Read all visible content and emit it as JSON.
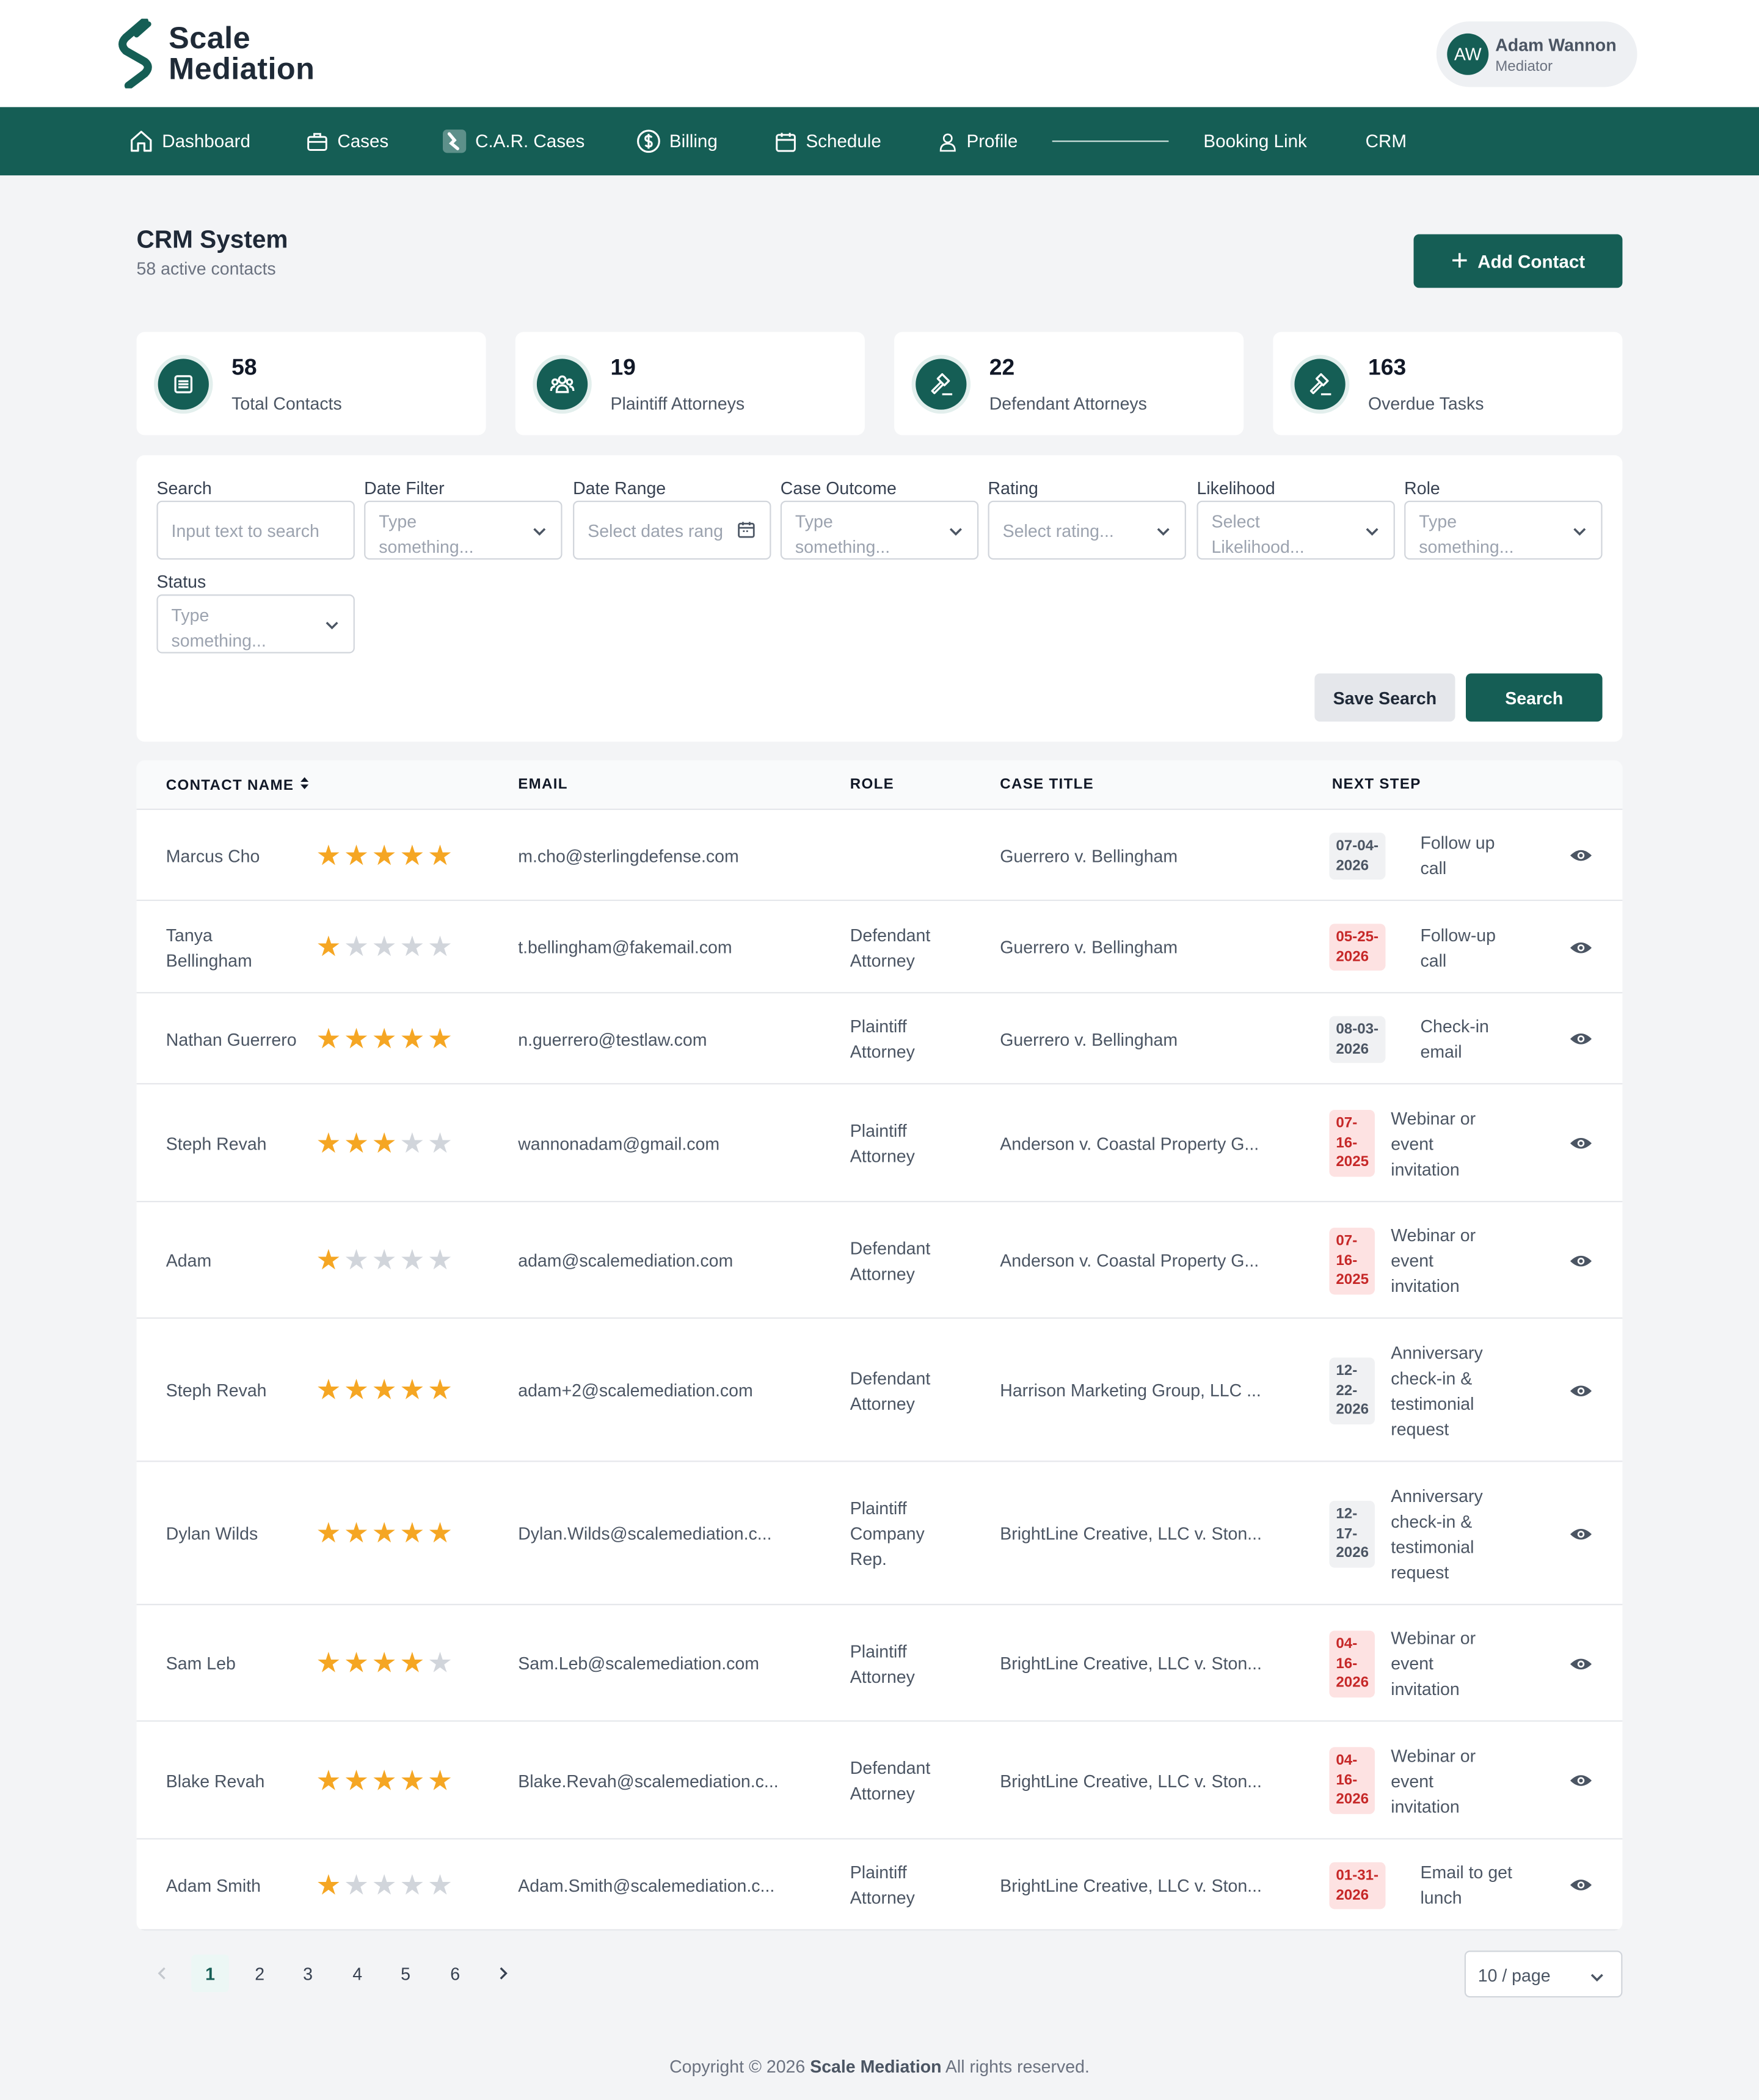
{
  "brand": {
    "line1": "Scale",
    "line2": "Mediation"
  },
  "user": {
    "initials": "AW",
    "name": "Adam Wannon",
    "role": "Mediator"
  },
  "nav": [
    {
      "label": "Dashboard",
      "icon": "home-icon"
    },
    {
      "label": "Cases",
      "icon": "briefcase-icon"
    },
    {
      "label": "C.A.R. Cases",
      "icon": "car-cases-icon"
    },
    {
      "label": "Billing",
      "icon": "dollar-icon"
    },
    {
      "label": "Schedule",
      "icon": "calendar-icon"
    },
    {
      "label": "Profile",
      "icon": "user-icon"
    },
    {
      "label": "Booking Link"
    },
    {
      "label": "CRM"
    }
  ],
  "page": {
    "title": "CRM System",
    "subtitle": "58 active contacts",
    "add_label": "Add Contact"
  },
  "stats": [
    {
      "value": "58",
      "label": "Total Contacts",
      "icon": "list-icon"
    },
    {
      "value": "19",
      "label": "Plaintiff Attorneys",
      "icon": "group-icon"
    },
    {
      "value": "22",
      "label": "Defendant Attorneys",
      "icon": "gavel-icon"
    },
    {
      "value": "163",
      "label": "Overdue Tasks",
      "icon": "gavel-icon"
    }
  ],
  "filters": {
    "search": {
      "label": "Search",
      "placeholder": "Input text to search"
    },
    "date_filter": {
      "label": "Date Filter",
      "placeholder": "Type something..."
    },
    "date_range": {
      "label": "Date Range",
      "placeholder": "Select dates rang"
    },
    "case_outcome": {
      "label": "Case Outcome",
      "placeholder": "Type something..."
    },
    "rating": {
      "label": "Rating",
      "placeholder": "Select rating..."
    },
    "likelihood": {
      "label": "Likelihood",
      "placeholder": "Select Likelihood..."
    },
    "role": {
      "label": "Role",
      "placeholder": "Type something..."
    },
    "status": {
      "label": "Status",
      "placeholder": "Type something..."
    },
    "save_label": "Save Search",
    "search_label": "Search"
  },
  "table": {
    "headers": {
      "name": "CONTACT NAME",
      "email": "EMAIL",
      "role": "ROLE",
      "case": "CASE TITLE",
      "next": "NEXT STEP"
    },
    "rows": [
      {
        "name": "Marcus Cho",
        "rating": 5,
        "email": "m.cho@sterlingdefense.com",
        "role": "",
        "case": "Guerrero v. Bellingham",
        "date": "07-04-\n2026",
        "overdue": false,
        "step": "Follow up\ncall"
      },
      {
        "name": "Tanya\nBellingham",
        "rating": 1,
        "email": "t.bellingham@fakemail.com",
        "role": "Defendant\nAttorney",
        "case": "Guerrero v. Bellingham",
        "date": "05-25-\n2026",
        "overdue": true,
        "step": "Follow-up\ncall"
      },
      {
        "name": "Nathan Guerrero",
        "rating": 5,
        "email": "n.guerrero@testlaw.com",
        "role": "Plaintiff\nAttorney",
        "case": "Guerrero v. Bellingham",
        "date": "08-03-\n2026",
        "overdue": false,
        "step": "Check-in\nemail"
      },
      {
        "name": "Steph Revah",
        "rating": 3,
        "email": "wannonadam@gmail.com",
        "role": "Plaintiff\nAttorney",
        "case": "Anderson v. Coastal Property G...",
        "date": "07-\n16-\n2025",
        "overdue": true,
        "step": "Webinar or\nevent\ninvitation"
      },
      {
        "name": "Adam",
        "rating": 1,
        "email": "adam@scalemediation.com",
        "role": "Defendant\nAttorney",
        "case": "Anderson v. Coastal Property G...",
        "date": "07-\n16-\n2025",
        "overdue": true,
        "step": "Webinar or\nevent\ninvitation"
      },
      {
        "name": "Steph Revah",
        "rating": 5,
        "email": "adam+2@scalemediation.com",
        "role": "Defendant\nAttorney",
        "case": "Harrison Marketing Group, LLC ...",
        "date": "12-\n22-\n2026",
        "overdue": false,
        "step": "Anniversary\ncheck-in &\ntestimonial\nrequest"
      },
      {
        "name": "Dylan Wilds",
        "rating": 5,
        "email": "Dylan.Wilds@scalemediation.c...",
        "role": "Plaintiff\nCompany\nRep.",
        "case": "BrightLine Creative, LLC v. Ston...",
        "date": "12-\n17-\n2026",
        "overdue": false,
        "step": "Anniversary\ncheck-in &\ntestimonial\nrequest"
      },
      {
        "name": "Sam Leb",
        "rating": 4,
        "email": "Sam.Leb@scalemediation.com",
        "role": "Plaintiff\nAttorney",
        "case": "BrightLine Creative, LLC v. Ston...",
        "date": "04-\n16-\n2026",
        "overdue": true,
        "step": "Webinar or\nevent\ninvitation"
      },
      {
        "name": "Blake Revah",
        "rating": 5,
        "email": "Blake.Revah@scalemediation.c...",
        "role": "Defendant\nAttorney",
        "case": "BrightLine Creative, LLC v. Ston...",
        "date": "04-\n16-\n2026",
        "overdue": true,
        "step": "Webinar or\nevent\ninvitation"
      },
      {
        "name": "Adam Smith",
        "rating": 1,
        "email": "Adam.Smith@scalemediation.c...",
        "role": "Plaintiff\nAttorney",
        "case": "BrightLine Creative, LLC v. Ston...",
        "date": "01-31-\n2026",
        "overdue": true,
        "step": "Email to get\nlunch"
      }
    ]
  },
  "pagination": {
    "pages": [
      "1",
      "2",
      "3",
      "4",
      "5",
      "6"
    ],
    "current": "1",
    "per_page": "10 / page"
  },
  "footer": {
    "prefix": "Copyright © 2026",
    "brand": "Scale Mediation",
    "suffix": "All rights reserved."
  },
  "colors": {
    "primary": "#155e55",
    "star": "#f5a623",
    "overdue_bg": "#fde2e2",
    "overdue_text": "#c62828"
  }
}
